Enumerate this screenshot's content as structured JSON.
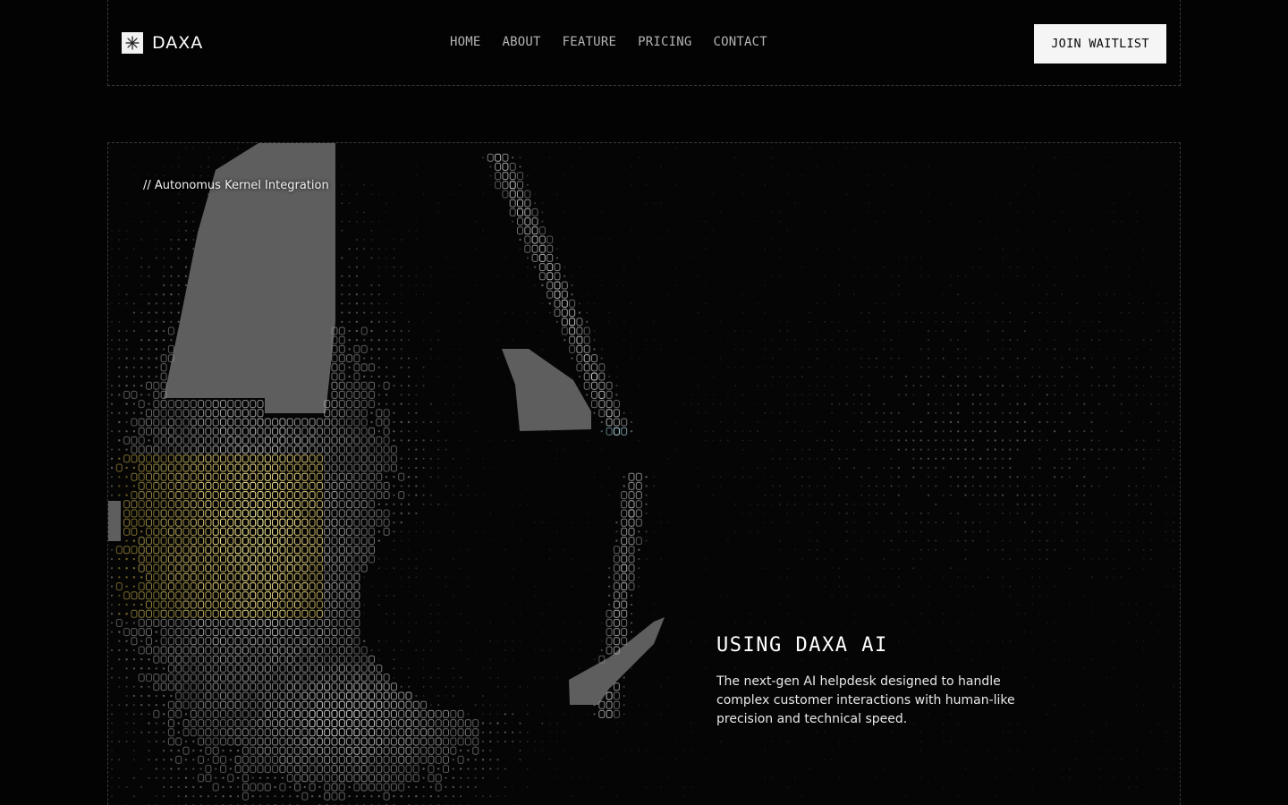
{
  "header": {
    "brand": {
      "name": "DAXA",
      "icon": "sparkle-icon"
    },
    "nav": [
      {
        "label": "HOME"
      },
      {
        "label": "ABOUT"
      },
      {
        "label": "FEATURE"
      },
      {
        "label": "PRICING"
      },
      {
        "label": "CONTACT"
      }
    ],
    "cta_label": "JOIN WAITLIST"
  },
  "hero": {
    "eyebrow": "// Autonomus Kernel Integration",
    "title": "USING DAXA AI",
    "description": "The next-gen AI helpdesk designed to handle complex customer interactions with human-like precision and technical speed.",
    "artwork": "ascii-dot-matrix-image"
  },
  "colors": {
    "background": "#030303",
    "border": "#3b3b3b",
    "text": "#ffffff",
    "nav_text": "#b4b4b4",
    "button_bg": "#f5f5f5",
    "button_text": "#0a0a0a"
  }
}
